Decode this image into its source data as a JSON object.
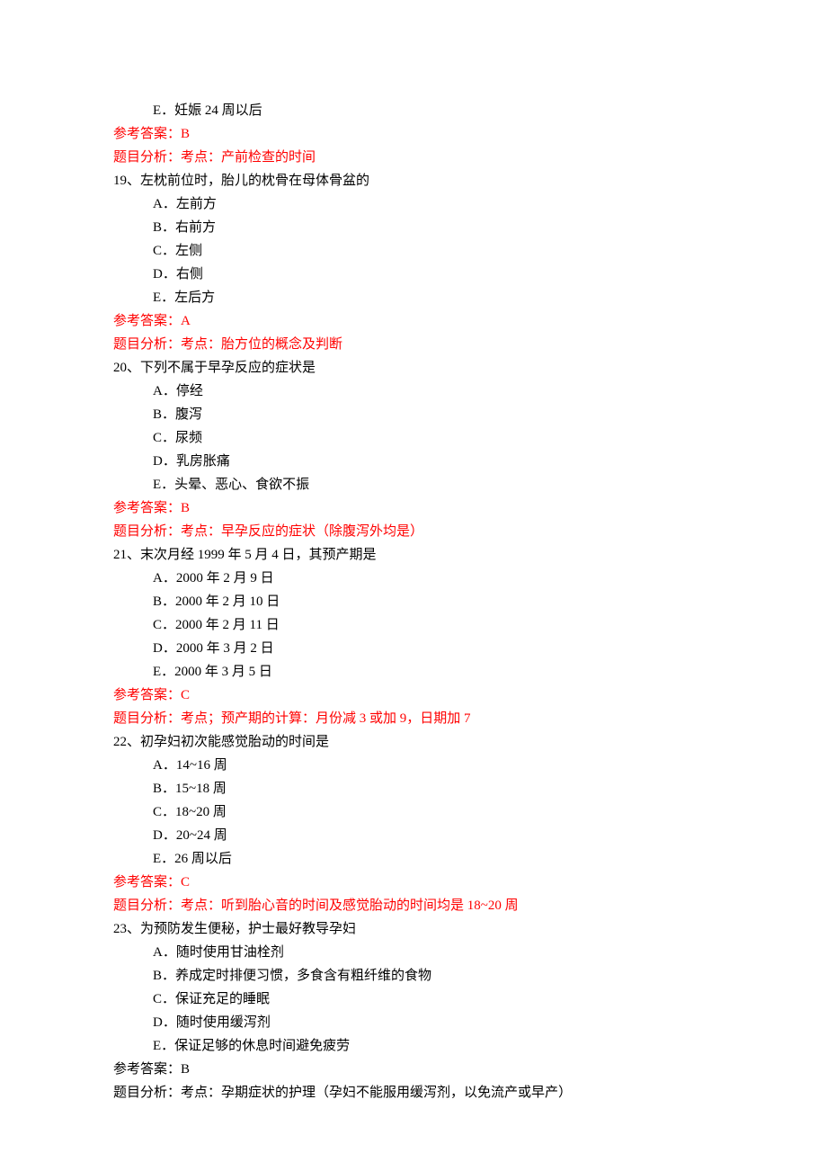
{
  "q18_trailing_option": {
    "label": "E．",
    "text": "妊娠 24 周以后"
  },
  "q18_answer_label": "参考答案：",
  "q18_answer_value": "B",
  "q18_analysis_label": "题目分析：",
  "q18_analysis_text": "考点：产前检查的时间",
  "q19_stem": "19、左枕前位时，胎儿的枕骨在母体骨盆的",
  "q19_options": [
    {
      "label": "A．",
      "text": "左前方"
    },
    {
      "label": "B．",
      "text": "右前方"
    },
    {
      "label": "C．",
      "text": "左侧"
    },
    {
      "label": "D．",
      "text": "右侧"
    },
    {
      "label": "E．",
      "text": "左后方"
    }
  ],
  "q19_answer_label": "参考答案：",
  "q19_answer_value": "A",
  "q19_analysis_label": "题目分析：",
  "q19_analysis_text": "考点：胎方位的概念及判断",
  "q20_stem": "20、下列不属于早孕反应的症状是",
  "q20_options": [
    {
      "label": "A．",
      "text": "停经"
    },
    {
      "label": "B．",
      "text": "腹泻"
    },
    {
      "label": "C．",
      "text": "尿频"
    },
    {
      "label": "D．",
      "text": "乳房胀痛"
    },
    {
      "label": "E．",
      "text": "头晕、恶心、食欲不振"
    }
  ],
  "q20_answer_label": "参考答案：",
  "q20_answer_value": "B",
  "q20_analysis_label": "题目分析：",
  "q20_analysis_text": "考点：早孕反应的症状（除腹泻外均是）",
  "q21_stem": "21、末次月经 1999 年 5 月 4 日，其预产期是",
  "q21_options": [
    {
      "label": "A．",
      "text": "2000 年 2 月 9 日"
    },
    {
      "label": "B．",
      "text": "2000 年 2 月 10 日"
    },
    {
      "label": "C．",
      "text": "2000 年 2 月 11 日"
    },
    {
      "label": "D．",
      "text": "2000 年 3 月 2 日"
    },
    {
      "label": "E．",
      "text": "2000 年 3 月 5 日"
    }
  ],
  "q21_answer_label": "参考答案：",
  "q21_answer_value": "C",
  "q21_analysis_label": "题目分析：",
  "q21_analysis_text": "考点；预产期的计算：月份减 3 或加 9，日期加 7",
  "q22_stem": "22、初孕妇初次能感觉胎动的时间是",
  "q22_options": [
    {
      "label": "A．",
      "text": "14~16 周"
    },
    {
      "label": "B．",
      "text": "15~18 周"
    },
    {
      "label": "C．",
      "text": "18~20 周"
    },
    {
      "label": "D．",
      "text": "20~24 周"
    },
    {
      "label": "E．",
      "text": "26 周以后"
    }
  ],
  "q22_answer_label": "参考答案：",
  "q22_answer_value": "C",
  "q22_analysis_label": "题目分析：",
  "q22_analysis_text": "考点：听到胎心音的时间及感觉胎动的时间均是 18~20 周",
  "q23_stem": "23、为预防发生便秘，护士最好教导孕妇",
  "q23_options": [
    {
      "label": "A．",
      "text": "随时使用甘油栓剂"
    },
    {
      "label": "B．",
      "text": "养成定时排便习惯，多食含有粗纤维的食物"
    },
    {
      "label": "C．",
      "text": "保证充足的睡眠"
    },
    {
      "label": "D．",
      "text": "随时使用缓泻剂"
    },
    {
      "label": "E．",
      "text": "保证足够的休息时间避免疲劳"
    }
  ],
  "q23_answer_label": "参考答案：",
  "q23_answer_value": "B",
  "q23_analysis_label": "题目分析：",
  "q23_analysis_text": "考点：孕期症状的护理（孕妇不能服用缓泻剂，以免流产或早产）"
}
